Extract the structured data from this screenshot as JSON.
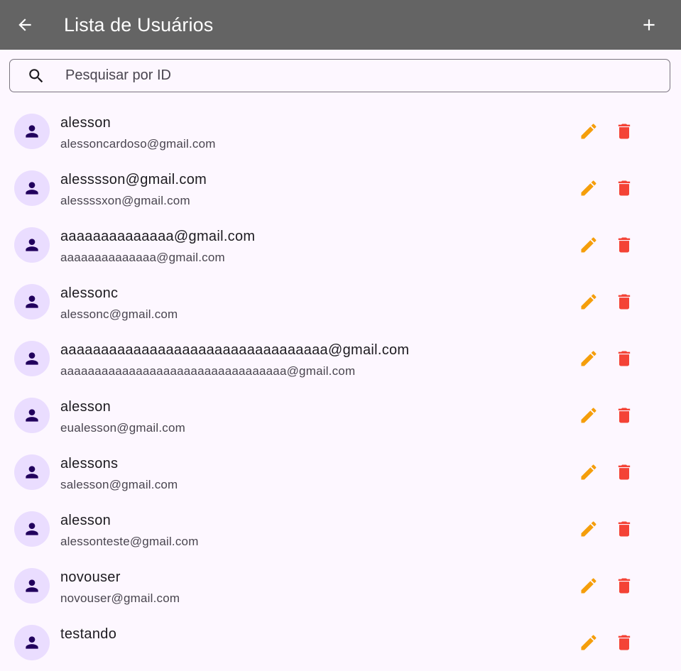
{
  "appbar": {
    "title": "Lista de Usuários",
    "back_icon": "arrow-back-icon",
    "add_icon": "add-icon",
    "background": "#646464"
  },
  "search": {
    "placeholder": "Pesquisar por ID",
    "value": "",
    "icon": "search-icon"
  },
  "colors": {
    "edit": "#f59e0b",
    "delete": "#f44336",
    "avatar_bg": "#eaddff",
    "avatar_fg": "#21005d"
  },
  "users": [
    {
      "name": "alesson",
      "email": "alessoncardoso@gmail.com"
    },
    {
      "name": "alesssson@gmail.com",
      "email": "alessssxon@gmail.com"
    },
    {
      "name": "aaaaaaaaaaaaaa@gmail.com",
      "email": "aaaaaaaaaaaaaa@gmail.com"
    },
    {
      "name": "alessonc",
      "email": "alessonc@gmail.com"
    },
    {
      "name": "aaaaaaaaaaaaaaaaaaaaaaaaaaaaaaaaa@gmail.com",
      "email": "aaaaaaaaaaaaaaaaaaaaaaaaaaaaaaaaa@gmail.com"
    },
    {
      "name": "alesson",
      "email": "eualesson@gmail.com"
    },
    {
      "name": "alessons",
      "email": "salesson@gmail.com"
    },
    {
      "name": "alesson",
      "email": "alessonteste@gmail.com"
    },
    {
      "name": "novouser",
      "email": "novouser@gmail.com"
    },
    {
      "name": "testando",
      "email": ""
    }
  ]
}
